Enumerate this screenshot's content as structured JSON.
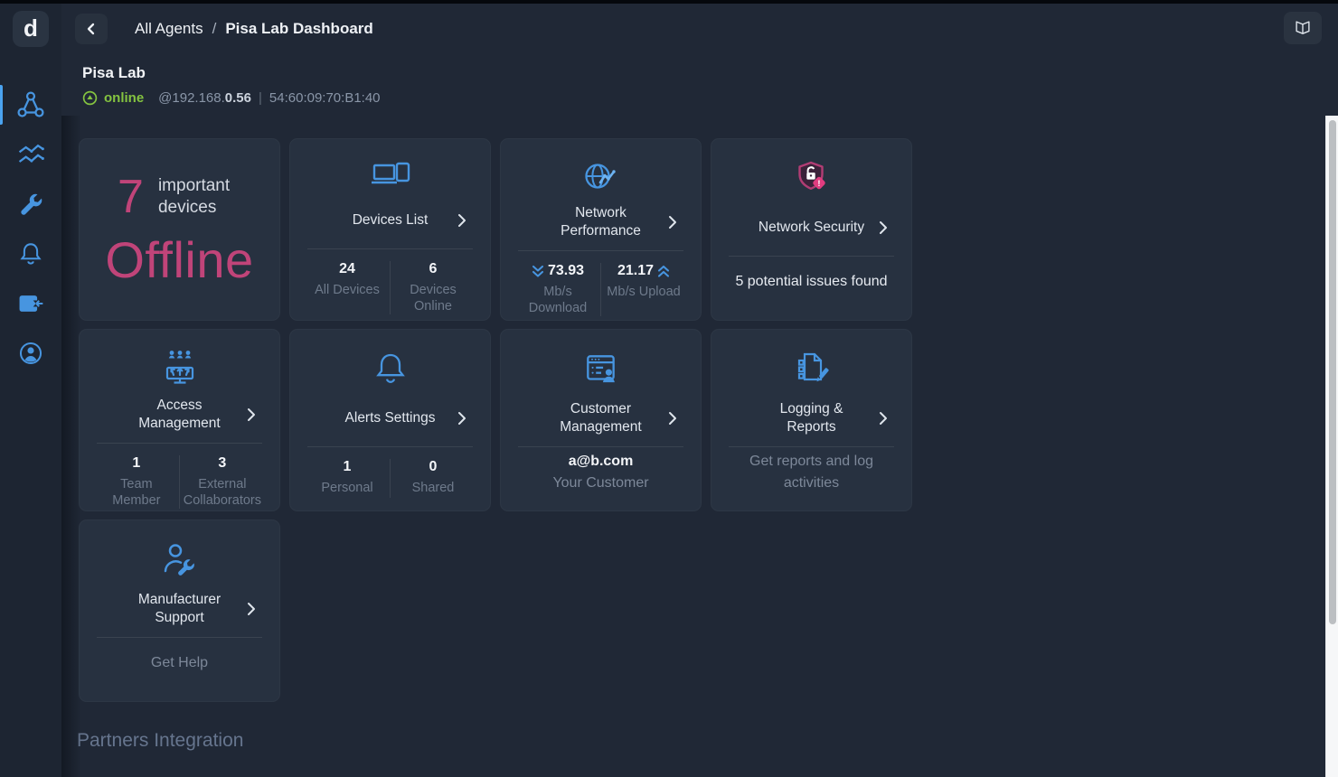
{
  "colors": {
    "accent_blue": "#4795e0",
    "accent_pink": "#c04479",
    "online_green": "#84c340",
    "card_bg": "#273140",
    "page_bg": "#202836"
  },
  "sidebar": {
    "logo": "d"
  },
  "header": {
    "breadcrumb_root": "All Agents",
    "breadcrumb_sep": "/",
    "breadcrumb_current": "Pisa Lab Dashboard"
  },
  "agent": {
    "name": "Pisa Lab",
    "status": "online",
    "ip_prefix": "@192.168.",
    "ip_bold": "0.56",
    "separator": "|",
    "mac": "54:60:09:70:B1:40"
  },
  "cards": {
    "offline": {
      "count": "7",
      "label": "important devices",
      "status": "Offline"
    },
    "devices": {
      "title": "Devices List",
      "stats": [
        {
          "value": "24",
          "label": "All Devices"
        },
        {
          "value": "6",
          "label": "Devices Online"
        }
      ]
    },
    "performance": {
      "title": "Network Performance",
      "stats": [
        {
          "value": "73.93",
          "label": "Mb/s Download",
          "direction": "down"
        },
        {
          "value": "21.17",
          "label": "Mb/s Upload",
          "direction": "up"
        }
      ]
    },
    "security": {
      "title": "Network Security",
      "note": "5 potential issues found"
    },
    "access": {
      "title": "Access Management",
      "stats": [
        {
          "value": "1",
          "label": "Team Member"
        },
        {
          "value": "3",
          "label": "External Collaborators"
        }
      ]
    },
    "alerts": {
      "title": "Alerts Settings",
      "stats": [
        {
          "value": "1",
          "label": "Personal"
        },
        {
          "value": "0",
          "label": "Shared"
        }
      ]
    },
    "customer": {
      "title": "Customer Management",
      "value": "a@b.com",
      "label": "Your Customer"
    },
    "logging": {
      "title": "Logging & Reports",
      "note": "Get reports and log activities"
    },
    "support": {
      "title": "Manufacturer Support",
      "note": "Get Help"
    }
  },
  "sections": {
    "partners": "Partners Integration"
  }
}
